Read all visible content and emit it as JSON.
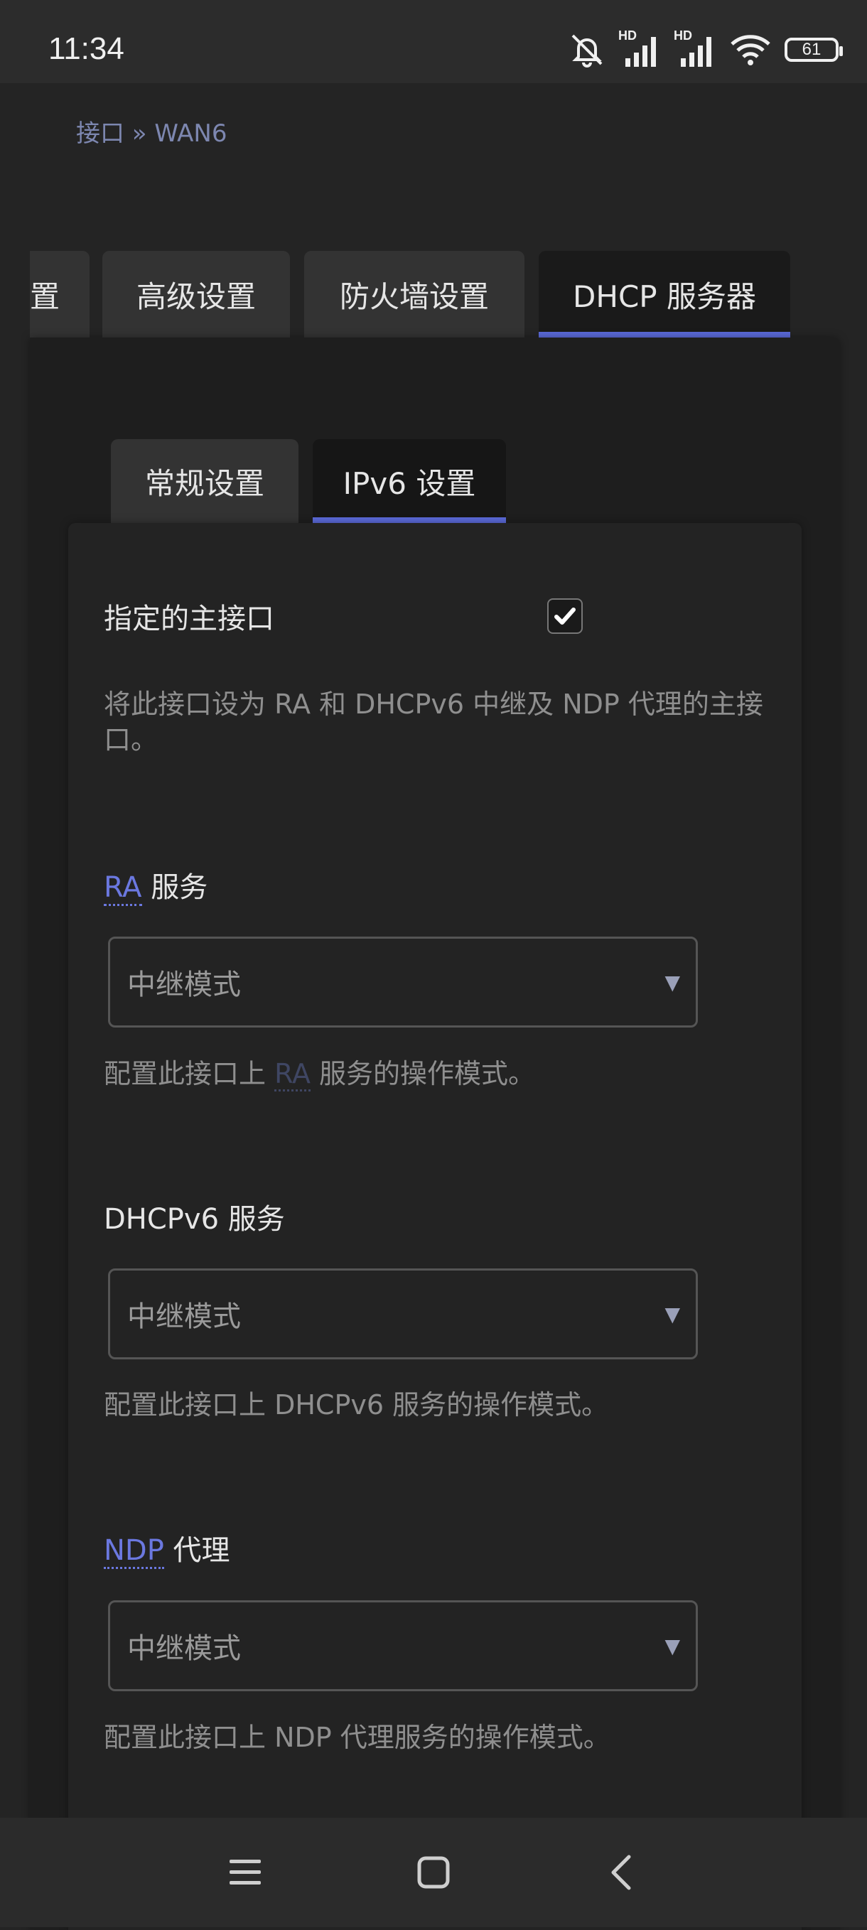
{
  "status": {
    "time": "11:34",
    "battery": "61",
    "network_labels": [
      "HD",
      "HD"
    ]
  },
  "breadcrumb": "接口 » WAN6",
  "top_tabs": [
    {
      "label": "置",
      "active": false
    },
    {
      "label": "高级设置",
      "active": false
    },
    {
      "label": "防火墙设置",
      "active": false
    },
    {
      "label": "DHCP 服务器",
      "active": true
    }
  ],
  "sub_tabs": [
    {
      "label": "常规设置",
      "active": false
    },
    {
      "label": "IPv6 设置",
      "active": true
    }
  ],
  "master_interface": {
    "label": "指定的主接口",
    "checked": true,
    "description": "将此接口设为 RA 和 DHCPv6 中继及 NDP 代理的主接口。"
  },
  "ra_service": {
    "label_abbr": "RA",
    "label_rest": " 服务",
    "value": "中继模式",
    "desc_before": "配置此接口上 ",
    "desc_abbr": "RA",
    "desc_after": " 服务的操作模式。"
  },
  "dhcpv6_service": {
    "label": "DHCPv6 服务",
    "value": "中继模式",
    "description": "配置此接口上 DHCPv6 服务的操作模式。"
  },
  "ndp_proxy": {
    "label_abbr": "NDP",
    "label_rest": " 代理",
    "value": "中继模式",
    "description": "配置此接口上 NDP 代理服务的操作模式。"
  },
  "icons": {
    "menu": "menu-icon",
    "home": "home-icon",
    "back": "back-icon"
  },
  "colors": {
    "accent": "#5b6ad9",
    "background": "#242424"
  }
}
